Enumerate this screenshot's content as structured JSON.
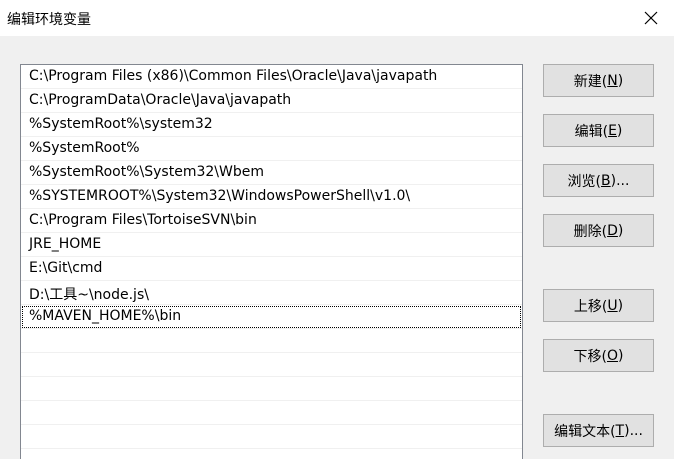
{
  "window": {
    "title": "编辑环境变量",
    "close_glyph": "✕"
  },
  "path_list": {
    "items": [
      "C:\\Program Files (x86)\\Common Files\\Oracle\\Java\\javapath",
      "C:\\ProgramData\\Oracle\\Java\\javapath",
      "%SystemRoot%\\system32",
      "%SystemRoot%",
      "%SystemRoot%\\System32\\Wbem",
      "%SYSTEMROOT%\\System32\\WindowsPowerShell\\v1.0\\",
      "C:\\Program Files\\TortoiseSVN\\bin",
      "JRE_HOME",
      "E:\\Git\\cmd",
      "D:\\工具~\\node.js\\",
      "%MAVEN_HOME%\\bin"
    ],
    "selected_index": 10
  },
  "buttons": {
    "new": {
      "pre": "新建(",
      "acc": "N",
      "post": ")"
    },
    "edit": {
      "pre": "编辑(",
      "acc": "E",
      "post": ")"
    },
    "browse": {
      "pre": "浏览(",
      "acc": "B",
      "post": ")..."
    },
    "delete": {
      "pre": "删除(",
      "acc": "D",
      "post": ")"
    },
    "move_up": {
      "pre": "上移(",
      "acc": "U",
      "post": ")"
    },
    "move_down": {
      "pre": "下移(",
      "acc": "O",
      "post": ")"
    },
    "edit_text": {
      "pre": "编辑文本(",
      "acc": "T",
      "post": ")..."
    }
  },
  "colors": {
    "titlebar": "#ffffff",
    "dialog_bg": "#f0f0f0",
    "list_bg": "#ffffff",
    "list_border": "#828790",
    "button_bg": "#e1e1e1",
    "button_border": "#adadad"
  }
}
